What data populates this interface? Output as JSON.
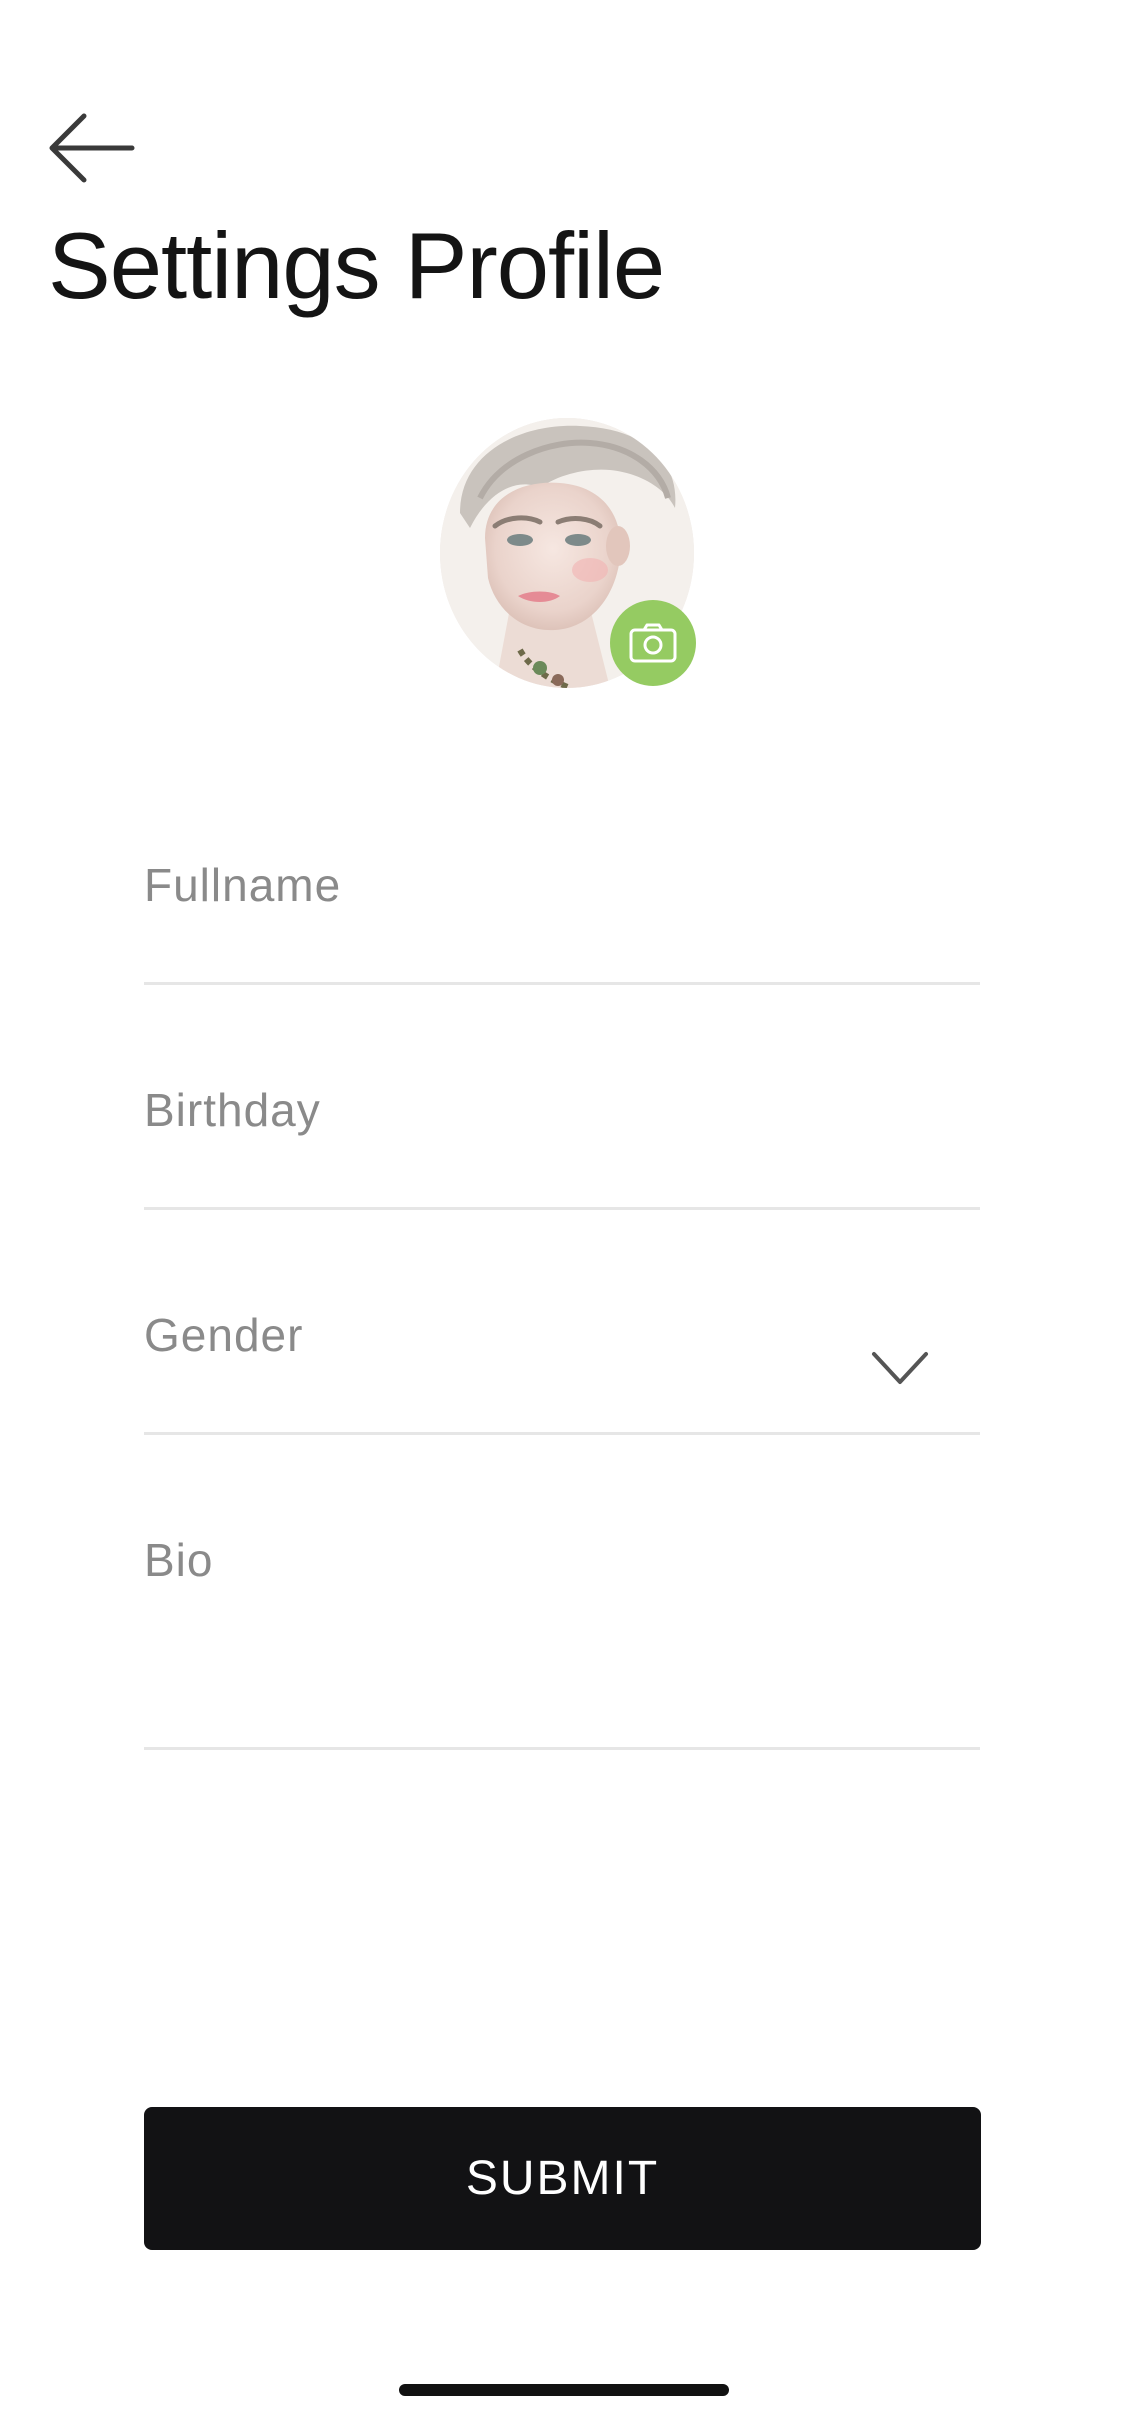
{
  "header": {
    "back_icon": "arrow-left-icon",
    "title": "Settings Profile"
  },
  "avatar": {
    "camera_icon": "camera-icon",
    "camera_badge_color": "#95cb62"
  },
  "form": {
    "fullname": {
      "label": "Fullname",
      "value": ""
    },
    "birthday": {
      "label": "Birthday",
      "value": ""
    },
    "gender": {
      "label": "Gender",
      "value": "",
      "icon": "chevron-down-icon"
    },
    "bio": {
      "label": "Bio",
      "value": ""
    }
  },
  "actions": {
    "submit_label": "SUBMIT",
    "submit_color": "#121214"
  }
}
